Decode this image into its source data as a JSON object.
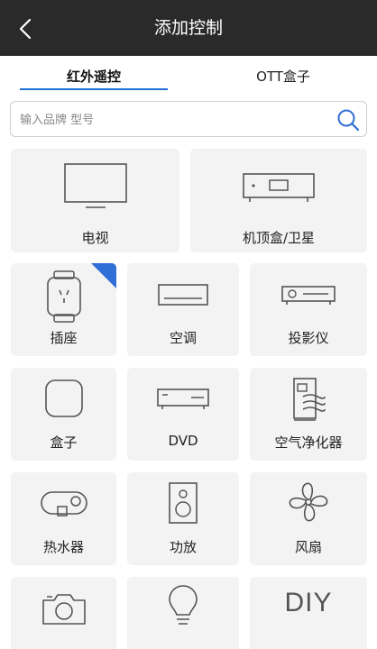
{
  "header": {
    "title": "添加控制",
    "back_icon": "back-arrow-icon"
  },
  "tabs": [
    {
      "label": "红外遥控",
      "active": true
    },
    {
      "label": "OTT盒子",
      "active": false
    }
  ],
  "search": {
    "placeholder": "输入品牌 型号",
    "value": "",
    "icon": "search-icon"
  },
  "devices": [
    {
      "label": "电视",
      "icon": "tv-icon"
    },
    {
      "label": "机顶盒/卫星",
      "icon": "set-top-box-icon"
    },
    {
      "label": "插座",
      "icon": "smart-plug-icon",
      "badge": true
    },
    {
      "label": "空调",
      "icon": "air-conditioner-icon"
    },
    {
      "label": "投影仪",
      "icon": "projector-icon"
    },
    {
      "label": "盒子",
      "icon": "box-icon"
    },
    {
      "label": "DVD",
      "icon": "dvd-player-icon"
    },
    {
      "label": "空气净化器",
      "icon": "air-purifier-icon"
    },
    {
      "label": "热水器",
      "icon": "water-heater-icon"
    },
    {
      "label": "功放",
      "icon": "speaker-icon"
    },
    {
      "label": "风扇",
      "icon": "fan-icon"
    },
    {
      "label": "",
      "icon": "camera-icon"
    },
    {
      "label": "",
      "icon": "light-bulb-icon"
    },
    {
      "label": "",
      "icon": "diy-icon",
      "icon_text": "DIY"
    }
  ],
  "colors": {
    "header_bg": "#2a2a2a",
    "accent": "#1f6fd6",
    "card_bg": "#f3f3f3"
  }
}
